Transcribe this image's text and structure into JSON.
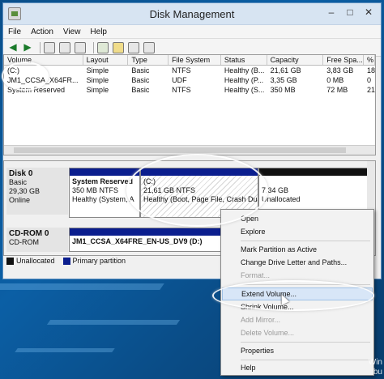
{
  "window": {
    "title": "Disk Management",
    "controls": {
      "minimize": "–",
      "maximize": "□",
      "close": "✕"
    }
  },
  "menu": [
    "File",
    "Action",
    "View",
    "Help"
  ],
  "toolbar_icons": [
    "back-arrow-icon",
    "forward-arrow-icon",
    "console-tree-icon",
    "help-icon",
    "properties-icon",
    "refresh-icon",
    "folder-icon",
    "rescan-icon",
    "settings-icon"
  ],
  "volume_list": {
    "columns": [
      "Volume",
      "Layout",
      "Type",
      "File System",
      "Status",
      "Capacity",
      "Free Spa...",
      "% F"
    ],
    "rows": [
      [
        "(C:)",
        "Simple",
        "Basic",
        "NTFS",
        "Healthy (B...",
        "21,61 GB",
        "3,83 GB",
        "18"
      ],
      [
        "JM1_CCSA_X64FR...",
        "Simple",
        "Basic",
        "UDF",
        "Healthy (P...",
        "3,35 GB",
        "0 MB",
        "0 "
      ],
      [
        "System Reserved",
        "Simple",
        "Basic",
        "NTFS",
        "Healthy (S...",
        "350 MB",
        "72 MB",
        "21"
      ]
    ]
  },
  "disks": [
    {
      "name": "Disk 0",
      "lines": [
        "Basic",
        "29,30 GB",
        "Online"
      ],
      "partitions": [
        {
          "title": "System Reserved",
          "size": "350 MB NTFS",
          "status": "Healthy (System, A"
        },
        {
          "title": "(C:)",
          "size": "21,61 GB NTFS",
          "status": "Healthy (Boot, Page File, Crash Dur"
        },
        {
          "title": "",
          "size": "7,34 GB",
          "status": "Unallocated"
        }
      ]
    },
    {
      "name": "CD-ROM 0",
      "lines": [
        "CD-ROM"
      ],
      "partitions": [
        {
          "title": "JM1_CCSA_X64FRE_EN-US_DV9 (D:)"
        }
      ]
    }
  ],
  "legend": [
    "Unallocated",
    "Primary partition"
  ],
  "colors": {
    "primary_partition": "#0b1e8e",
    "unallocated": "#111111",
    "accent": "#0b5fa5"
  },
  "context_menu": [
    {
      "label": "Open",
      "enabled": true
    },
    {
      "label": "Explore",
      "enabled": true
    },
    {
      "label": "Mark Partition as Active",
      "enabled": true
    },
    {
      "label": "Change Drive Letter and Paths...",
      "enabled": true
    },
    {
      "label": "Format...",
      "enabled": false
    },
    {
      "label": "Extend Volume...",
      "enabled": true,
      "highlighted": true
    },
    {
      "label": "Shrink Volume...",
      "enabled": true
    },
    {
      "label": "Add Mirror...",
      "enabled": false
    },
    {
      "label": "Delete Volume...",
      "enabled": false
    },
    {
      "label": "Properties",
      "enabled": true
    },
    {
      "label": "Help",
      "enabled": true
    }
  ],
  "watermark": [
    "Win",
    "bu"
  ]
}
